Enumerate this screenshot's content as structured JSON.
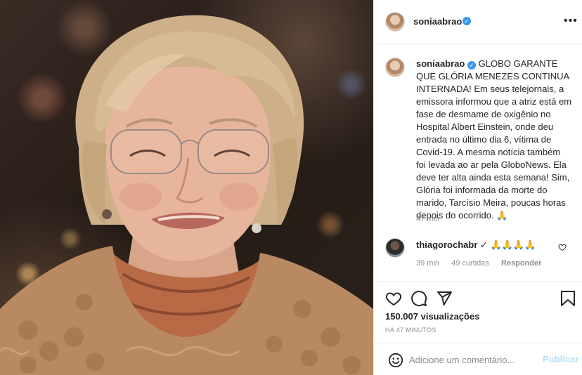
{
  "post": {
    "username": "soniaabrao",
    "more_icon": "more-horizontal-icon",
    "caption": "GLOBO GARANTE QUE GLÓRIA MENEZES CONTINUA INTERNADA! Em seus telejornais, a emissora informou que a atriz está em fase de desmame de oxigênio no Hospital Albert Einstein, onde deu entrada no último dia 6, vítima de Covid-19. A mesma notícia também foi levada ao ar pela GloboNews. Ela deve ter alta ainda esta semana! Sim, Glória foi informada da morte do marido, Tarcísio Meira, poucas horas depois do ocorrido. 🙏",
    "caption_time": "47 min",
    "verified_glyph": "✓"
  },
  "comment": {
    "username": "thiagorochabr",
    "text": "🙏🙏🙏🙏",
    "time": "39 min",
    "likes": "49 curtidas",
    "reply_label": "Responder"
  },
  "stats": {
    "views": "150.007 visualizações",
    "posted_ago": "HÁ 47 MINUTOS"
  },
  "composer": {
    "placeholder": "Adicione um comentário...",
    "publish_label": "Publicar"
  },
  "colors": {
    "verified": "#3897f0",
    "publish_disabled": "#b2dffc",
    "secondary_text": "#8e8e8e"
  }
}
